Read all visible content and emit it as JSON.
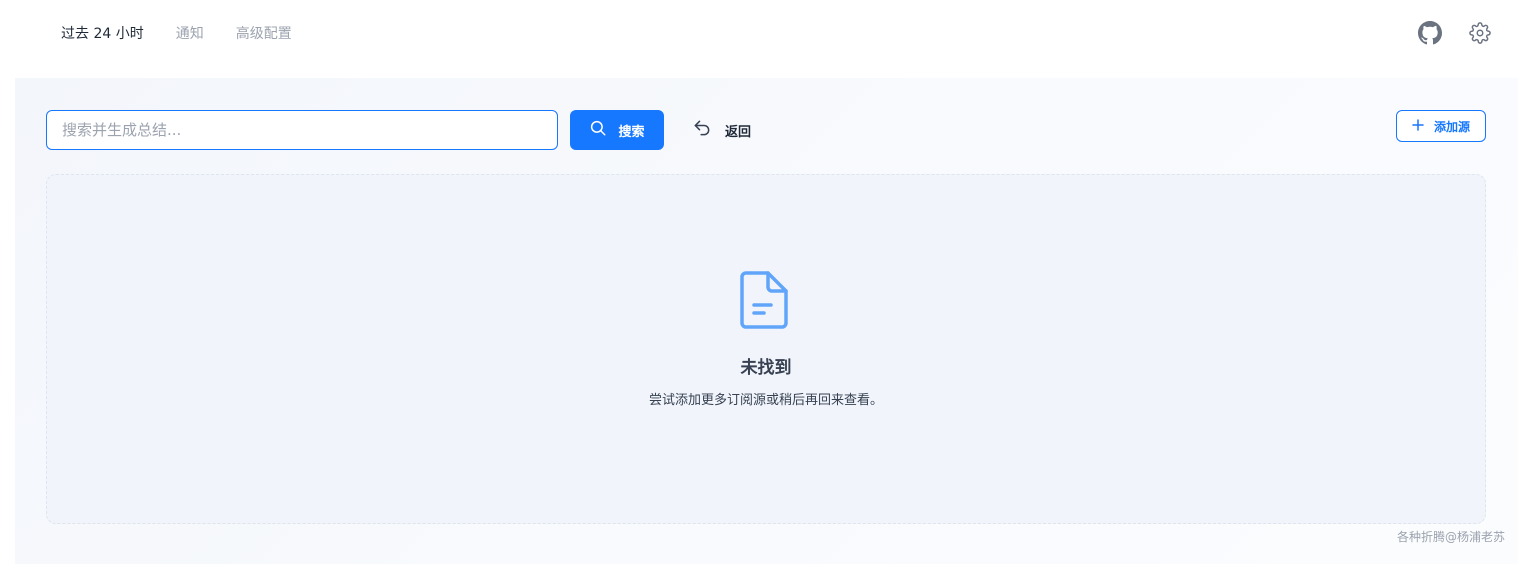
{
  "nav": {
    "items": [
      {
        "label": "过去 24 小时",
        "active": true
      },
      {
        "label": "通知",
        "active": false
      },
      {
        "label": "高级配置",
        "active": false
      }
    ]
  },
  "header_icons": [
    "github-icon",
    "gear-icon"
  ],
  "search": {
    "placeholder": "搜索并生成总结...",
    "value": "",
    "button_label": "搜索"
  },
  "back": {
    "label": "返回"
  },
  "add_source": {
    "label": "添加源"
  },
  "empty_state": {
    "icon": "document-icon",
    "title": "未找到",
    "description": "尝试添加更多订阅源或稍后再回来查看。"
  },
  "footer": {
    "text": "各种折腾@杨浦老苏"
  },
  "colors": {
    "accent": "#1677ff",
    "panel_bg": "#f1f5fb",
    "icon_blue": "#60a5fa"
  }
}
